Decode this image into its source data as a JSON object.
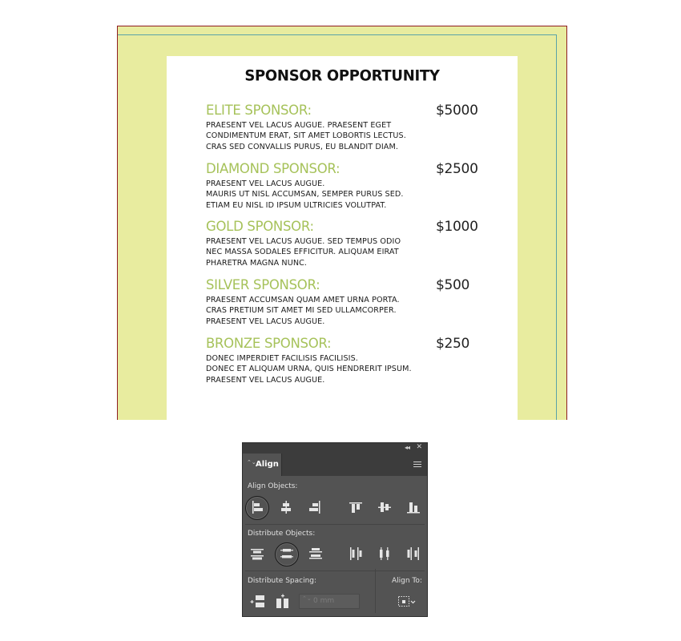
{
  "document": {
    "title": "SPONSOR OPPORTUNITY",
    "tiers": [
      {
        "name": "ELITE SPONSOR:",
        "price": "$5000",
        "lines": [
          "PRAESENT VEL LACUS AUGUE. PRAESENT EGET",
          "CONDIMENTUM ERAT, SIT AMET LOBORTIS LECTUS.",
          "CRAS SED CONVALLIS PURUS, EU BLANDIT DIAM."
        ]
      },
      {
        "name": "DIAMOND SPONSOR:",
        "price": "$2500",
        "lines": [
          "PRAESENT VEL LACUS AUGUE.",
          "MAURIS UT NISL ACCUMSAN, SEMPER PURUS SED.",
          "ETIAM EU NISL ID IPSUM ULTRICIES VOLUTPAT."
        ]
      },
      {
        "name": "GOLD SPONSOR:",
        "price": "$1000",
        "lines": [
          "PRAESENT VEL LACUS AUGUE. SED TEMPUS ODIO",
          "NEC MASSA SODALES EFFICITUR. ALIQUAM EIRAT",
          "PHARETRA MAGNA NUNC."
        ]
      },
      {
        "name": "SILVER SPONSOR:",
        "price": "$500",
        "lines": [
          "PRAESENT ACCUMSAN QUAM AMET URNA PORTA.",
          "CRAS PRETIUM SIT AMET MI SED ULLAMCORPER.",
          "PRAESENT VEL LACUS AUGUE."
        ]
      },
      {
        "name": "BRONZE SPONSOR:",
        "price": "$250",
        "lines": [
          "DONEC IMPERDIET FACILISIS FACILISIS.",
          "DONEC ET ALIQUAM URNA, QUIS HENDRERIT IPSUM.",
          "PRAESENT VEL LACUS AUGUE."
        ]
      }
    ]
  },
  "panel": {
    "collapse_glyph": "◂◂",
    "close_glyph": "✕",
    "tab_label": "Align",
    "tab_arrows": "⌃⌄",
    "align_objects_label": "Align Objects:",
    "distribute_objects_label": "Distribute Objects:",
    "distribute_spacing_label": "Distribute Spacing:",
    "align_to_label": "Align To:",
    "spacing_stepper": "⌃⌄",
    "spacing_value": "0 mm"
  },
  "colors": {
    "tier_accent": "#a6c25a",
    "page_bleed": "#e8ec9f",
    "panel_bg": "#535353"
  }
}
